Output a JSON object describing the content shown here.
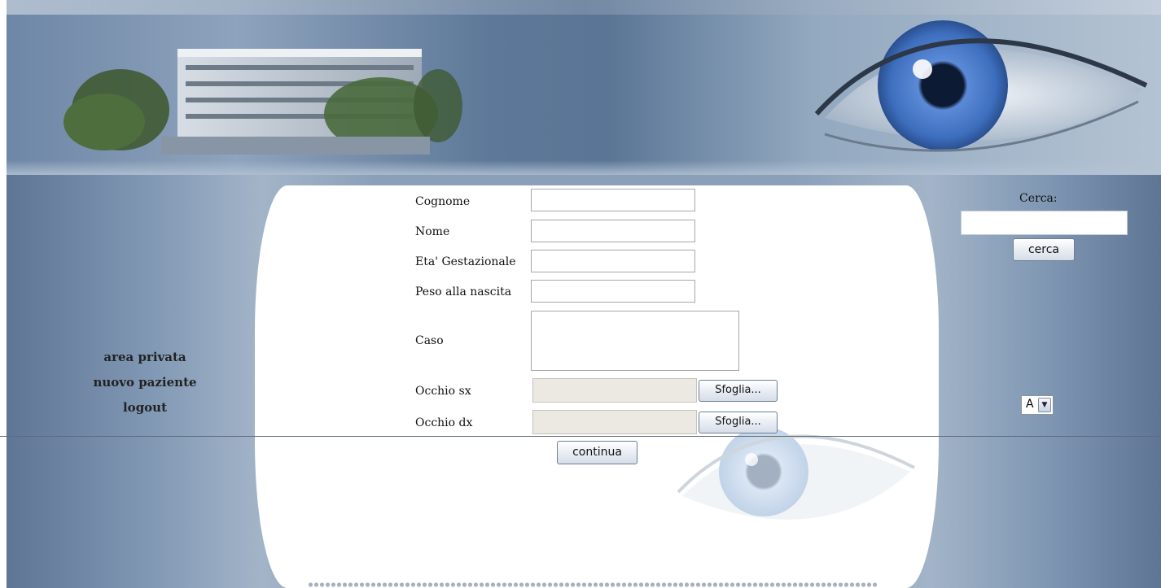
{
  "form": {
    "fields": [
      {
        "label": "Cognome",
        "value": ""
      },
      {
        "label": "Nome",
        "value": ""
      },
      {
        "label": "Eta' Gestazionale",
        "value": ""
      },
      {
        "label": "Peso alla nascita",
        "value": ""
      }
    ],
    "caso_label": "Caso",
    "caso_value": "",
    "occhio_sx_label": "Occhio sx",
    "occhio_dx_label": "Occhio dx",
    "browse_label": "Sfoglia...",
    "continue_label": "continua"
  },
  "menu": {
    "items": [
      "area privata",
      "nuovo paziente",
      "logout"
    ]
  },
  "search": {
    "label": "Cerca:",
    "value": "",
    "button_label": "cerca"
  },
  "font_size_select": {
    "selected": "A"
  },
  "colors": {
    "background_blue": "#8aa0b9",
    "panel_white": "#ffffff",
    "button_border": "#6f7f93"
  }
}
